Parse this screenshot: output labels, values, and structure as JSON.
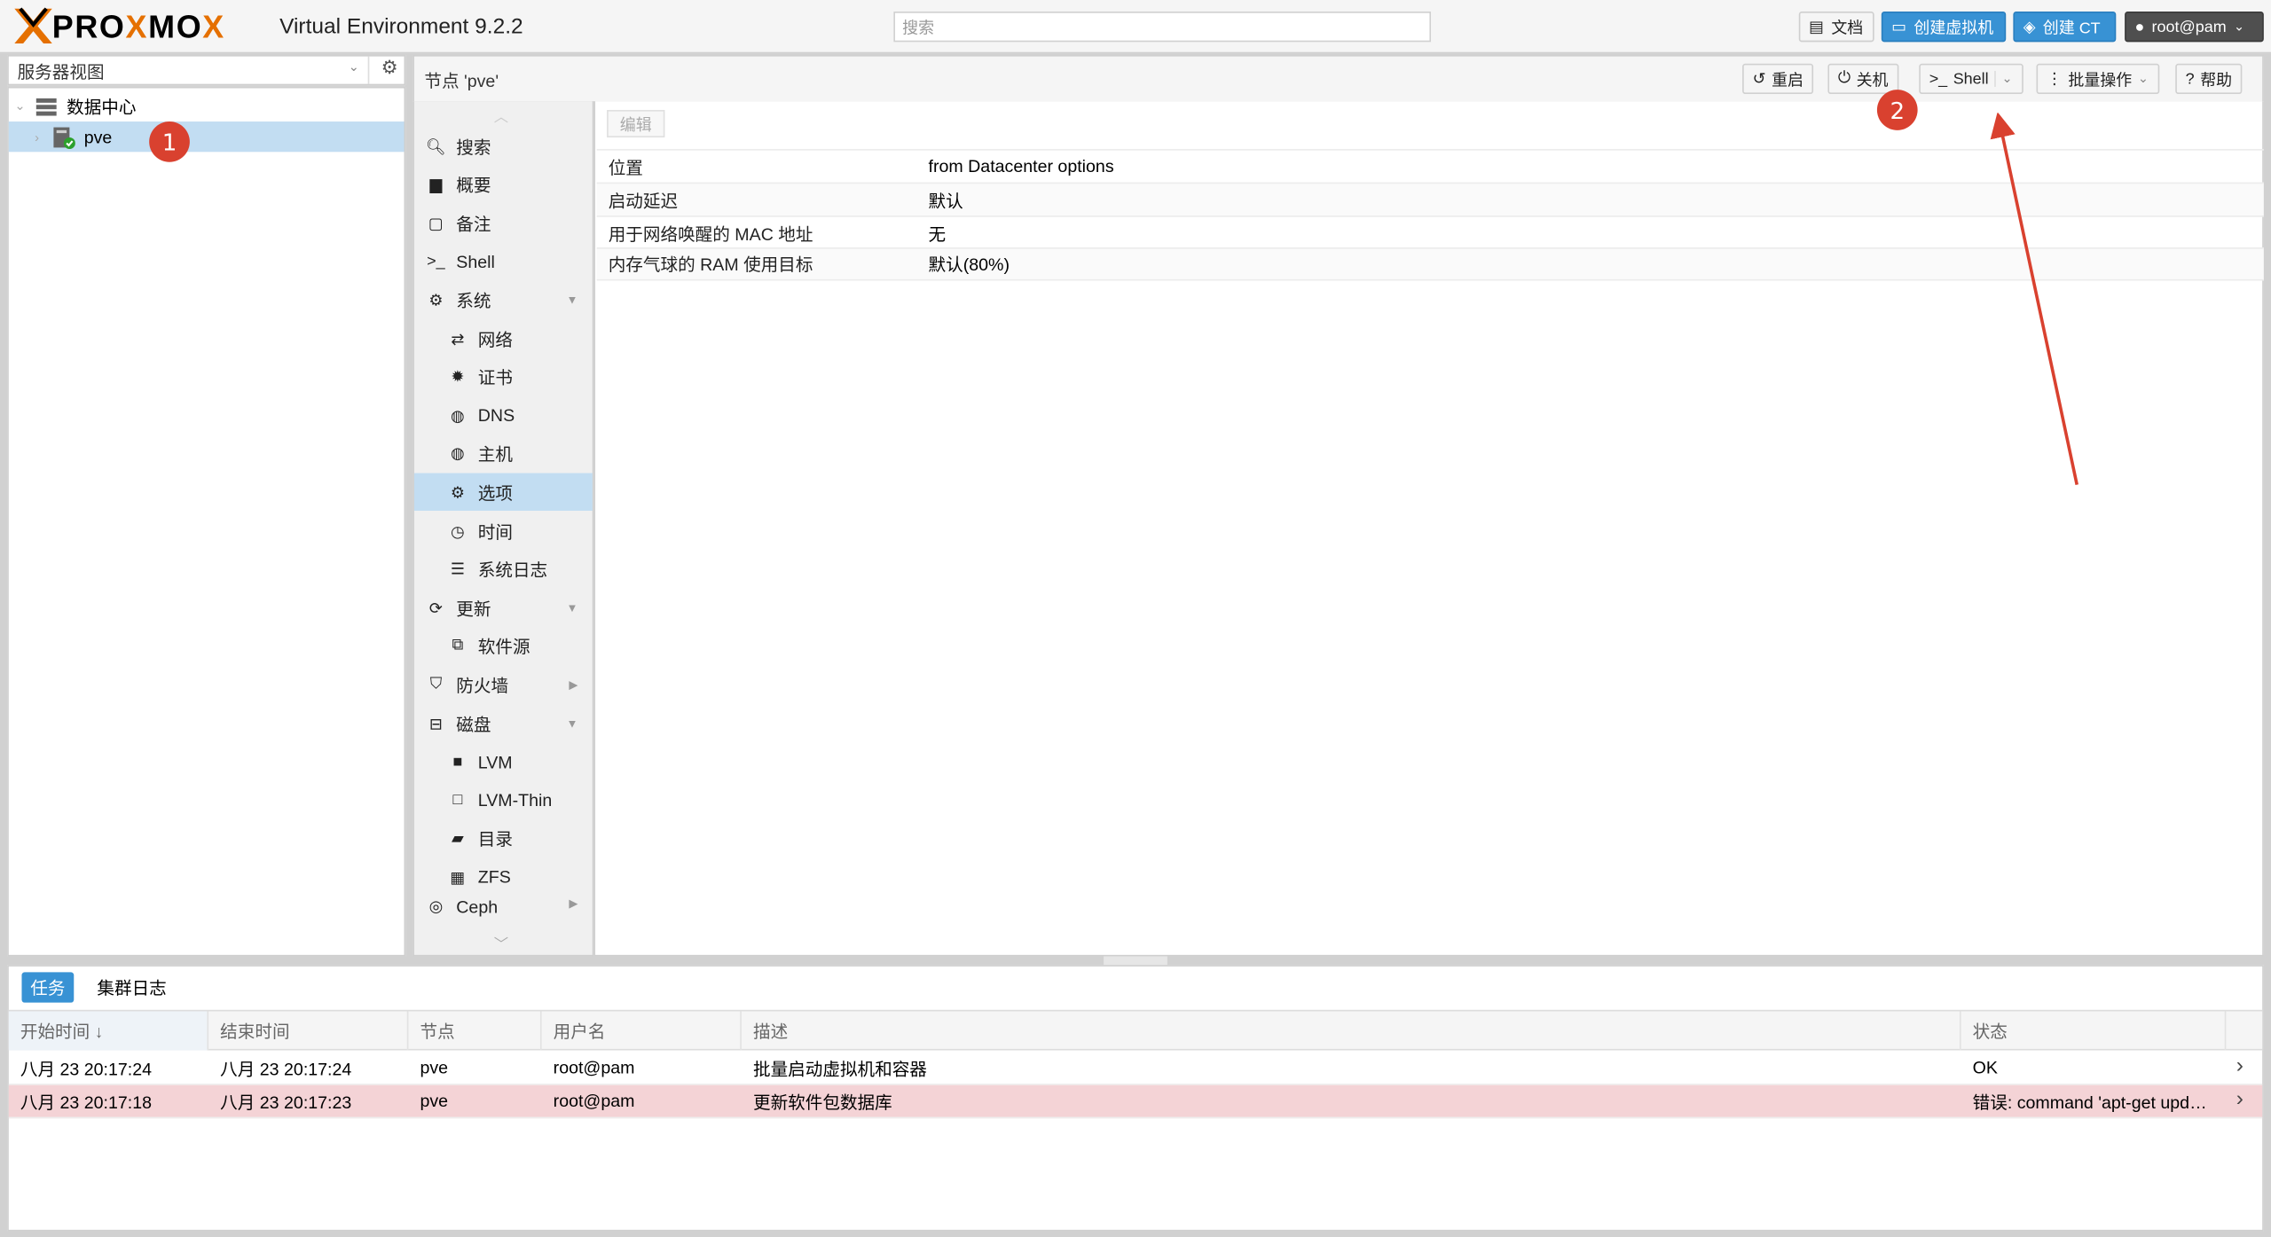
{
  "app": {
    "logo": "PROXMOX",
    "version": "Virtual Environment 9.2.2",
    "search_placeholder": "搜索",
    "docs_label": "文档",
    "create_vm_label": "创建虚拟机",
    "create_ct_label": "创建 CT",
    "user_label": "root@pam"
  },
  "left_panel": {
    "view_selector": "服务器视图",
    "tree": [
      {
        "label": "数据中心",
        "icon": "datacenter-icon"
      },
      {
        "label": "pve",
        "icon": "node-online-icon",
        "selected": true
      }
    ]
  },
  "node_header": {
    "title": "节点 'pve'",
    "reboot_label": "重启",
    "shutdown_label": "关机",
    "shell_label": "Shell",
    "bulk_label": "批量操作",
    "help_label": "帮助"
  },
  "nav": {
    "items": [
      {
        "label": "搜索",
        "icon": "search-icon"
      },
      {
        "label": "概要",
        "icon": "book-icon"
      },
      {
        "label": "备注",
        "icon": "note-icon"
      },
      {
        "label": "Shell",
        "icon": "terminal-icon"
      },
      {
        "label": "系统",
        "icon": "cogs-icon",
        "expandable": true
      },
      {
        "label": "网络",
        "icon": "exchange-icon",
        "sub": true
      },
      {
        "label": "证书",
        "icon": "certificate-icon",
        "sub": true
      },
      {
        "label": "DNS",
        "icon": "globe-icon",
        "sub": true
      },
      {
        "label": "主机",
        "icon": "globe-icon",
        "sub": true
      },
      {
        "label": "选项",
        "icon": "gear-icon",
        "sub": true,
        "active": true
      },
      {
        "label": "时间",
        "icon": "clock-icon",
        "sub": true
      },
      {
        "label": "系统日志",
        "icon": "list-icon",
        "sub": true
      },
      {
        "label": "更新",
        "icon": "refresh-icon",
        "expandable": true
      },
      {
        "label": "软件源",
        "icon": "files-icon",
        "sub": true
      },
      {
        "label": "防火墙",
        "icon": "shield-icon",
        "collapsed": true
      },
      {
        "label": "磁盘",
        "icon": "hdd-icon",
        "expandable": true
      },
      {
        "label": "LVM",
        "icon": "square-icon",
        "sub": true
      },
      {
        "label": "LVM-Thin",
        "icon": "square-outline-icon",
        "sub": true
      },
      {
        "label": "目录",
        "icon": "folder-icon",
        "sub": true
      },
      {
        "label": "ZFS",
        "icon": "th-large-icon",
        "sub": true
      },
      {
        "label": "Ceph",
        "icon": "ceph-icon",
        "collapsed": true
      }
    ]
  },
  "options": {
    "edit_label": "编辑",
    "rows": [
      {
        "key": "位置",
        "value": "from Datacenter options"
      },
      {
        "key": "启动延迟",
        "value": "默认"
      },
      {
        "key": "用于网络唤醒的 MAC 地址",
        "value": "无"
      },
      {
        "key": "内存气球的 RAM 使用目标",
        "value": "默认(80%)"
      }
    ]
  },
  "tasks": {
    "tabs": [
      "任务",
      "集群日志"
    ],
    "columns": [
      "开始时间 ↓",
      "结束时间",
      "节点",
      "用户名",
      "描述",
      "状态"
    ],
    "rows": [
      {
        "start": "八月 23 20:17:24",
        "end": "八月 23 20:17:24",
        "node": "pve",
        "user": "root@pam",
        "desc": "批量启动虚拟机和容器",
        "status": "OK",
        "error": false
      },
      {
        "start": "八月 23 20:17:18",
        "end": "八月 23 20:17:23",
        "node": "pve",
        "user": "root@pam",
        "desc": "更新软件包数据库",
        "status": "错误: command 'apt-get upd…",
        "error": true
      }
    ]
  },
  "annotations": {
    "badge1": "1",
    "badge2": "2",
    "arrow_color": "#d9412f"
  }
}
